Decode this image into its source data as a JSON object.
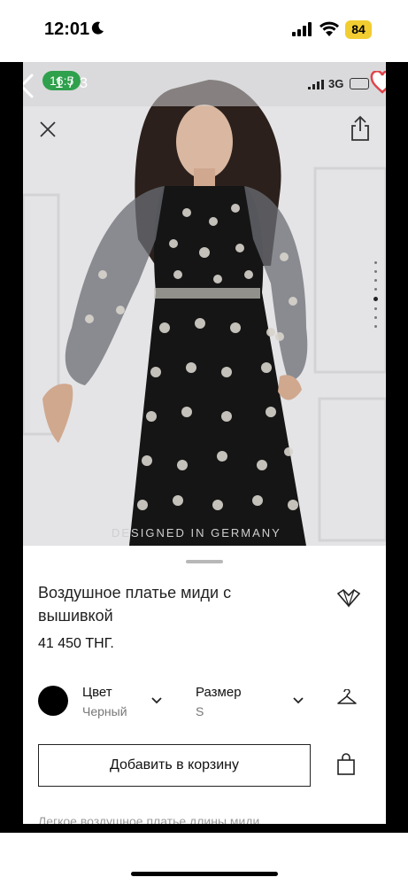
{
  "status_bar": {
    "time": "12:01",
    "battery": "84"
  },
  "inner_status": {
    "network": "3G",
    "page_indicator": "1 / 3",
    "pill_text": "16:5"
  },
  "photo": {
    "brand_text": "DESIGNED IN GERMANY",
    "pages_total": 8,
    "active_page": 5
  },
  "product": {
    "title": "Воздушное платье миди с вышивкой",
    "price": "41 450 ТНГ.",
    "color_label": "Цвет",
    "color_value": "Черный",
    "size_label": "Размер",
    "size_value": "S",
    "add_to_cart": "Добавить в корзину",
    "description_snippet": "Легкое воздушное платье длины миди"
  },
  "colors": {
    "accent_green": "#2fa04c",
    "swatch": "#000000",
    "heart": "#e0444a",
    "battery_yellow": "#f2cd31"
  },
  "icons": [
    "moon-icon",
    "signal-icon",
    "wifi-icon",
    "back-chevron-icon",
    "heart-icon",
    "close-icon",
    "share-icon",
    "fav-logo-icon",
    "chevron-down-icon",
    "hanger-icon",
    "bag-icon"
  ]
}
